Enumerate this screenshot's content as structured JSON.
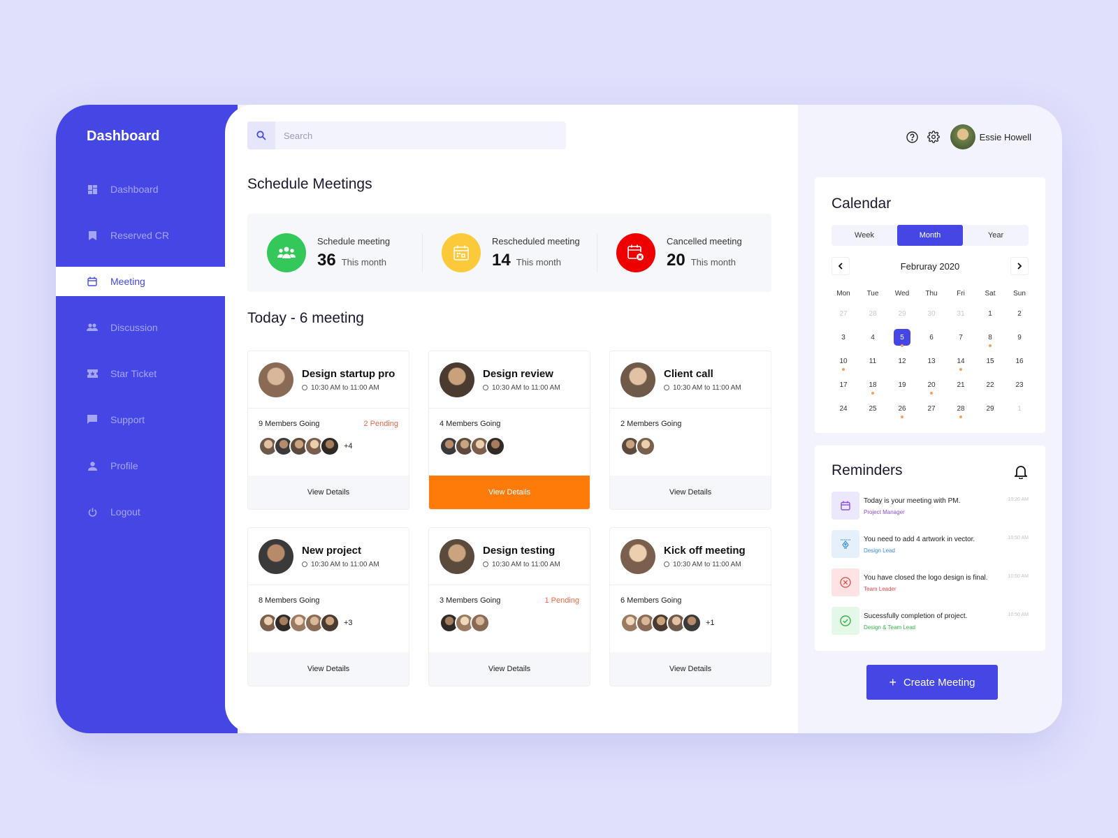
{
  "sidebar": {
    "brand": "Dashboard",
    "items": [
      {
        "label": "Dashboard",
        "icon": "dashboard-icon",
        "active": false
      },
      {
        "label": "Reserved CR",
        "icon": "bookmark-icon",
        "active": false
      },
      {
        "label": "Meeting",
        "icon": "calendar-icon",
        "active": true
      },
      {
        "label": "Discussion",
        "icon": "people-icon",
        "active": false
      },
      {
        "label": "Star Ticket",
        "icon": "ticket-icon",
        "active": false
      },
      {
        "label": "Support",
        "icon": "chat-icon",
        "active": false
      },
      {
        "label": "Profile",
        "icon": "person-icon",
        "active": false
      },
      {
        "label": "Logout",
        "icon": "power-icon",
        "active": false
      }
    ],
    "accent": "#4447e3",
    "active_marker_color": "#f6c543"
  },
  "search": {
    "placeholder": "Search",
    "value": ""
  },
  "schedule": {
    "title": "Schedule Meetings",
    "stats": [
      {
        "label": "Schedule meeting",
        "value": "36",
        "sub": "This month",
        "color": "#34c759",
        "icon": "group-icon"
      },
      {
        "label": "Rescheduled meeting",
        "value": "14",
        "sub": "This month",
        "color": "#fcc93a",
        "icon": "calendar-grid-icon"
      },
      {
        "label": "Cancelled meeting",
        "value": "20",
        "sub": "This month",
        "color": "#ee0000",
        "icon": "calendar-cancel-icon"
      }
    ]
  },
  "today": {
    "title": "Today - 6 meeting",
    "view_label": "View Details",
    "meetings": [
      {
        "title": "Design startup pro",
        "time": "10:30 AM to 11:00 AM",
        "members": "9 Members Going",
        "pending": "2 Pending",
        "more": "+4",
        "avatars": 5,
        "highlight": false
      },
      {
        "title": "Design review",
        "time": "10:30 AM to 11:00 AM",
        "members": "4 Members Going",
        "pending": "",
        "more": "",
        "avatars": 4,
        "highlight": true
      },
      {
        "title": "Client call",
        "time": "10:30 AM to 11:00 AM",
        "members": "2 Members Going",
        "pending": "",
        "more": "",
        "avatars": 2,
        "highlight": false
      },
      {
        "title": "New project",
        "time": "10:30 AM to 11:00 AM",
        "members": "8 Members Going",
        "pending": "",
        "more": "+3",
        "avatars": 5,
        "highlight": false
      },
      {
        "title": "Design testing",
        "time": "10:30 AM to 11:00 AM",
        "members": "3 Members Going",
        "pending": "1 Pending",
        "more": "",
        "avatars": 3,
        "highlight": false
      },
      {
        "title": "Kick off meeting",
        "time": "10:30 AM to 11:00 AM",
        "members": "6 Members Going",
        "pending": "",
        "more": "+1",
        "avatars": 5,
        "highlight": false
      }
    ]
  },
  "user": {
    "name": "Essie Howell"
  },
  "calendar": {
    "title": "Calendar",
    "views": [
      "Week",
      "Month",
      "Year"
    ],
    "active_view": "Month",
    "month": "Februray 2020",
    "weekdays": [
      "Mon",
      "Tue",
      "Wed",
      "Thu",
      "Fri",
      "Sat",
      "Sun"
    ],
    "days": [
      {
        "n": "27",
        "muted": true
      },
      {
        "n": "28",
        "muted": true
      },
      {
        "n": "29",
        "muted": true
      },
      {
        "n": "30",
        "muted": true
      },
      {
        "n": "31",
        "muted": true
      },
      {
        "n": "1"
      },
      {
        "n": "2"
      },
      {
        "n": "3"
      },
      {
        "n": "4"
      },
      {
        "n": "5",
        "selected": true,
        "dot": true
      },
      {
        "n": "6"
      },
      {
        "n": "7"
      },
      {
        "n": "8",
        "dot": true
      },
      {
        "n": "9"
      },
      {
        "n": "10",
        "dot": true
      },
      {
        "n": "11"
      },
      {
        "n": "12"
      },
      {
        "n": "13"
      },
      {
        "n": "14",
        "dot": true
      },
      {
        "n": "15"
      },
      {
        "n": "16"
      },
      {
        "n": "17"
      },
      {
        "n": "18",
        "dot": true
      },
      {
        "n": "19"
      },
      {
        "n": "20",
        "dot": true
      },
      {
        "n": "21"
      },
      {
        "n": "22"
      },
      {
        "n": "23"
      },
      {
        "n": "24"
      },
      {
        "n": "25"
      },
      {
        "n": "26",
        "dot": true
      },
      {
        "n": "27"
      },
      {
        "n": "28",
        "dot": true
      },
      {
        "n": "29"
      },
      {
        "n": "1",
        "muted": true
      }
    ]
  },
  "reminders": {
    "title": "Reminders",
    "items": [
      {
        "text": "Today is your meeting with PM.",
        "sub": "Project Manager",
        "time": "10:20 AM",
        "color": "#8a4fd8",
        "bg": "#ebe7fc",
        "icon": "calendar-icon"
      },
      {
        "text": "You need to add 4 artwork in vector.",
        "sub": "Design Lead",
        "time": "10:50 AM",
        "color": "#3a8ee6",
        "bg": "#e6f0fd",
        "icon": "pen-tool-icon"
      },
      {
        "text": "You have closed the logo design is final.",
        "sub": "Team Leader",
        "time": "10:50 AM",
        "color": "#e04b4b",
        "bg": "#fde3e3",
        "icon": "close-circle-icon"
      },
      {
        "text": "Sucessfully completion of project.",
        "sub": "Design & Team Lead",
        "time": "10:50 AM",
        "color": "#35b54a",
        "bg": "#e3f8e6",
        "icon": "check-circle-icon"
      }
    ]
  },
  "create_button": {
    "label": "Create Meeting"
  }
}
